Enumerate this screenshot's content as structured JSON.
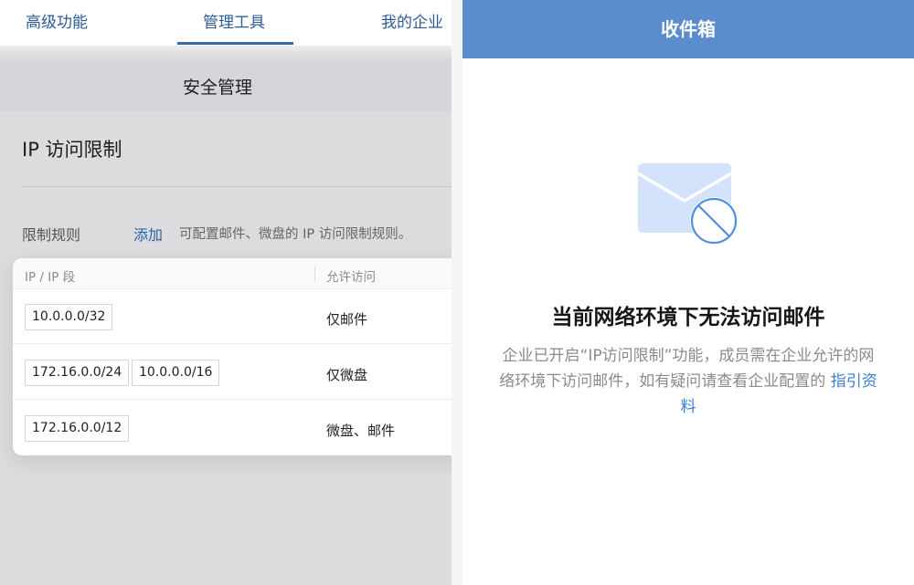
{
  "tabs": [
    {
      "label": "高级功能"
    },
    {
      "label": "管理工具"
    },
    {
      "label": "我的企业"
    }
  ],
  "section": {
    "title": "安全管理"
  },
  "ip_restriction": {
    "heading": "IP 访问限制",
    "rules_label": "限制规则",
    "add_label": "添加",
    "description": "可配置邮件、微盘的 IP 访问限制规则。",
    "table": {
      "col_ip": "IP / IP 段",
      "col_allow": "允许访问",
      "rows": [
        {
          "ips": [
            "10.0.0.0/32"
          ],
          "allow": "仅邮件"
        },
        {
          "ips": [
            "172.16.0.0/24",
            "10.0.0.0/16"
          ],
          "allow": "仅微盘"
        },
        {
          "ips": [
            "172.16.0.0/12"
          ],
          "allow": "微盘、邮件"
        }
      ]
    }
  },
  "inbox": {
    "title": "收件箱",
    "icon": "mail-blocked-icon",
    "message_title": "当前网络环境下无法访问邮件",
    "message_body": "企业已开启“IP访问限制”功能，成员需在企业允许的网络环境下访问邮件，如有疑问请查看企业配置的",
    "guide_link": "指引资料"
  },
  "colors": {
    "accent": "#5b8ccb",
    "tab_text": "#2c5b96",
    "link": "#3b7fd1",
    "icon_fill": "#d3e3fb",
    "icon_stroke": "#4d8fe0"
  }
}
